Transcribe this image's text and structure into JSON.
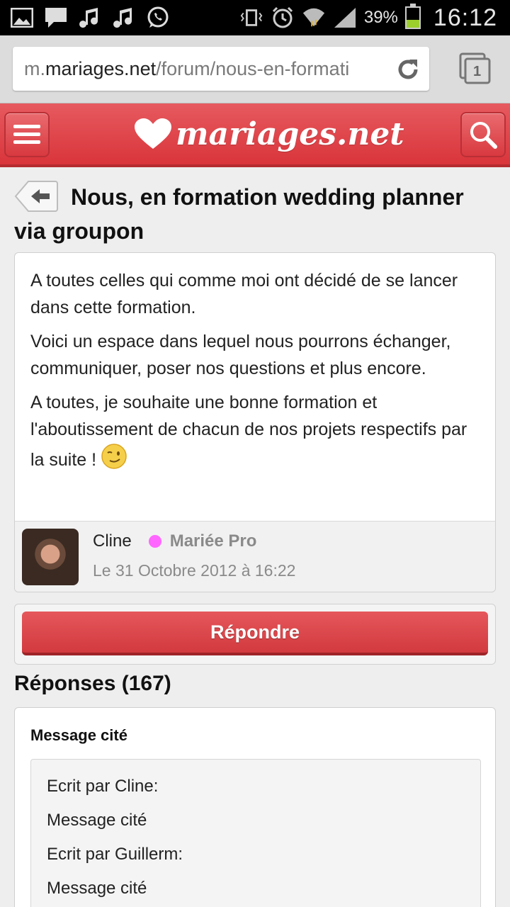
{
  "status_bar": {
    "battery_percent": "39%",
    "battery_level": 0.39,
    "time": "16:12",
    "icons": [
      "gallery-icon",
      "message-icon",
      "music-note-icon",
      "music-note-icon",
      "whatsapp-icon",
      "vibrate-icon",
      "alarm-icon",
      "wifi-icon",
      "signal-icon",
      "battery-icon"
    ]
  },
  "browser": {
    "url_prefix": "m.",
    "url_host": "mariages.net",
    "url_path": "/forum/nous-en-formati",
    "tab_count": "1"
  },
  "header": {
    "logo_text": "mariages.net",
    "brand_color": "#d9353b"
  },
  "page": {
    "title": "Nous, en formation wedding planner via groupon",
    "post": {
      "paragraphs": [
        "A toutes celles qui comme moi ont décidé de se lancer dans cette formation.",
        "Voici un espace dans lequel nous pourrons échanger, communiquer, poser nos questions et plus encore.",
        "A toutes, je souhaite une bonne formation et l'aboutissement de chacun de nos projets respectifs par la suite !"
      ],
      "author": "Cline",
      "author_role": "Mariée Pro",
      "role_color": "#ff66ff",
      "date": "Le 31 Octobre 2012 à 16:22"
    },
    "reply_button_label": "Répondre",
    "responses_heading": "Réponses (167)",
    "reply": {
      "quote_label": "Message cité",
      "quote_lines": [
        "Ecrit par Cline:",
        "Message cité",
        "Ecrit par Guillerm:",
        "Message cité"
      ]
    }
  }
}
